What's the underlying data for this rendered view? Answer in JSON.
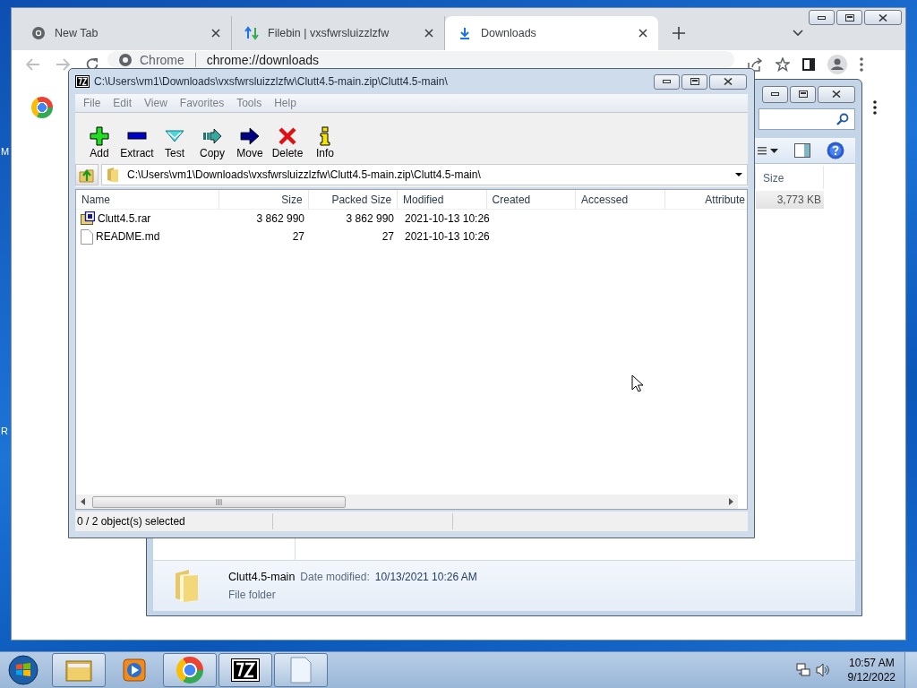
{
  "desktop": {
    "icon_labels": [
      "M",
      "R"
    ]
  },
  "browser": {
    "tabs": [
      {
        "label": "New Tab",
        "kind": "chrome",
        "selected": false
      },
      {
        "label": "Filebin | vxsfwrsluizzlzfw",
        "kind": "transfer",
        "selected": false
      },
      {
        "label": "Downloads",
        "kind": "download",
        "selected": true
      }
    ],
    "omnibox": {
      "origin": "Chrome",
      "url": "chrome://downloads"
    }
  },
  "explorer": {
    "columns": [
      "Size"
    ],
    "rows": [
      {
        "size": "3,773 KB",
        "selected": true
      }
    ],
    "details": {
      "name": "Clutt4.5-main",
      "date_label": "Date modified:",
      "date": "10/13/2021 10:26 AM",
      "type": "File folder"
    }
  },
  "sevenzip": {
    "title": "C:\\Users\\vm1\\Downloads\\vxsfwrsluizzlzfw\\Clutt4.5-main.zip\\Clutt4.5-main\\",
    "menu": [
      "File",
      "Edit",
      "View",
      "Favorites",
      "Tools",
      "Help"
    ],
    "toolbar": [
      {
        "label": "Add",
        "kind": "add"
      },
      {
        "label": "Extract",
        "kind": "extract"
      },
      {
        "label": "Test",
        "kind": "test"
      },
      {
        "label": "Copy",
        "kind": "copy"
      },
      {
        "label": "Move",
        "kind": "move"
      },
      {
        "label": "Delete",
        "kind": "delete"
      },
      {
        "label": "Info",
        "kind": "info"
      }
    ],
    "path": "C:\\Users\\vm1\\Downloads\\vxsfwrsluizzlzfw\\Clutt4.5-main.zip\\Clutt4.5-main\\",
    "columns": [
      "Name",
      "Size",
      "Packed Size",
      "Modified",
      "Created",
      "Accessed",
      "Attribute"
    ],
    "rows": [
      {
        "name": "Clutt4.5.rar",
        "kind": "archive",
        "size": "3 862 990",
        "packed": "3 862 990",
        "modified": "2021-10-13 10:26"
      },
      {
        "name": "README.md",
        "kind": "file",
        "size": "27",
        "packed": "27",
        "modified": "2021-10-13 10:26"
      }
    ],
    "status": "0 / 2 object(s) selected"
  },
  "taskbar": {
    "items": [
      {
        "kind": "explorer",
        "running": true
      },
      {
        "kind": "media",
        "running": false
      },
      {
        "kind": "chrome",
        "running": true
      },
      {
        "kind": "sevenzip",
        "running": true
      },
      {
        "kind": "file",
        "running": true
      }
    ],
    "time": "10:57 AM",
    "date": "9/12/2022"
  }
}
